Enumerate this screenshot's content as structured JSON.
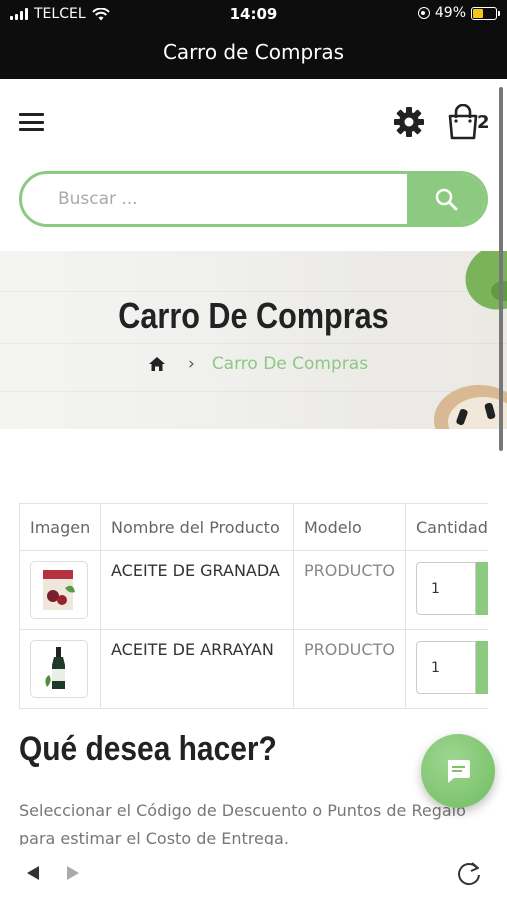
{
  "status_bar": {
    "carrier": "TELCEL",
    "time": "14:09",
    "battery": "49%"
  },
  "window": {
    "title": "Carro de Compras"
  },
  "header": {
    "cart_count": "2"
  },
  "search": {
    "placeholder": "Buscar ..."
  },
  "banner": {
    "title": "Carro De Compras",
    "breadcrumb_current": "Carro De Compras"
  },
  "cart_table": {
    "headers": [
      "Imagen",
      "Nombre del Producto",
      "Modelo",
      "Cantidad"
    ],
    "rows": [
      {
        "name": "ACEITE DE GRANADA",
        "model": "PRODUCTO",
        "quantity": "1"
      },
      {
        "name": "ACEITE DE ARRAYAN",
        "model": "PRODUCTO",
        "quantity": "1"
      }
    ]
  },
  "actions": {
    "title": "Qué desea hacer?",
    "text": "Seleccionar el Código de Descuento o Puntos de Regalo para estimar el Costo de Entrega."
  },
  "colors": {
    "accent": "#8cc981",
    "topbar": "#0d0d0d"
  },
  "icons": [
    "menu-icon",
    "gear-icon",
    "shopping-bag-icon",
    "search-icon",
    "home-icon",
    "chat-icon",
    "back-arrow-icon",
    "forward-arrow-icon",
    "reload-icon"
  ]
}
